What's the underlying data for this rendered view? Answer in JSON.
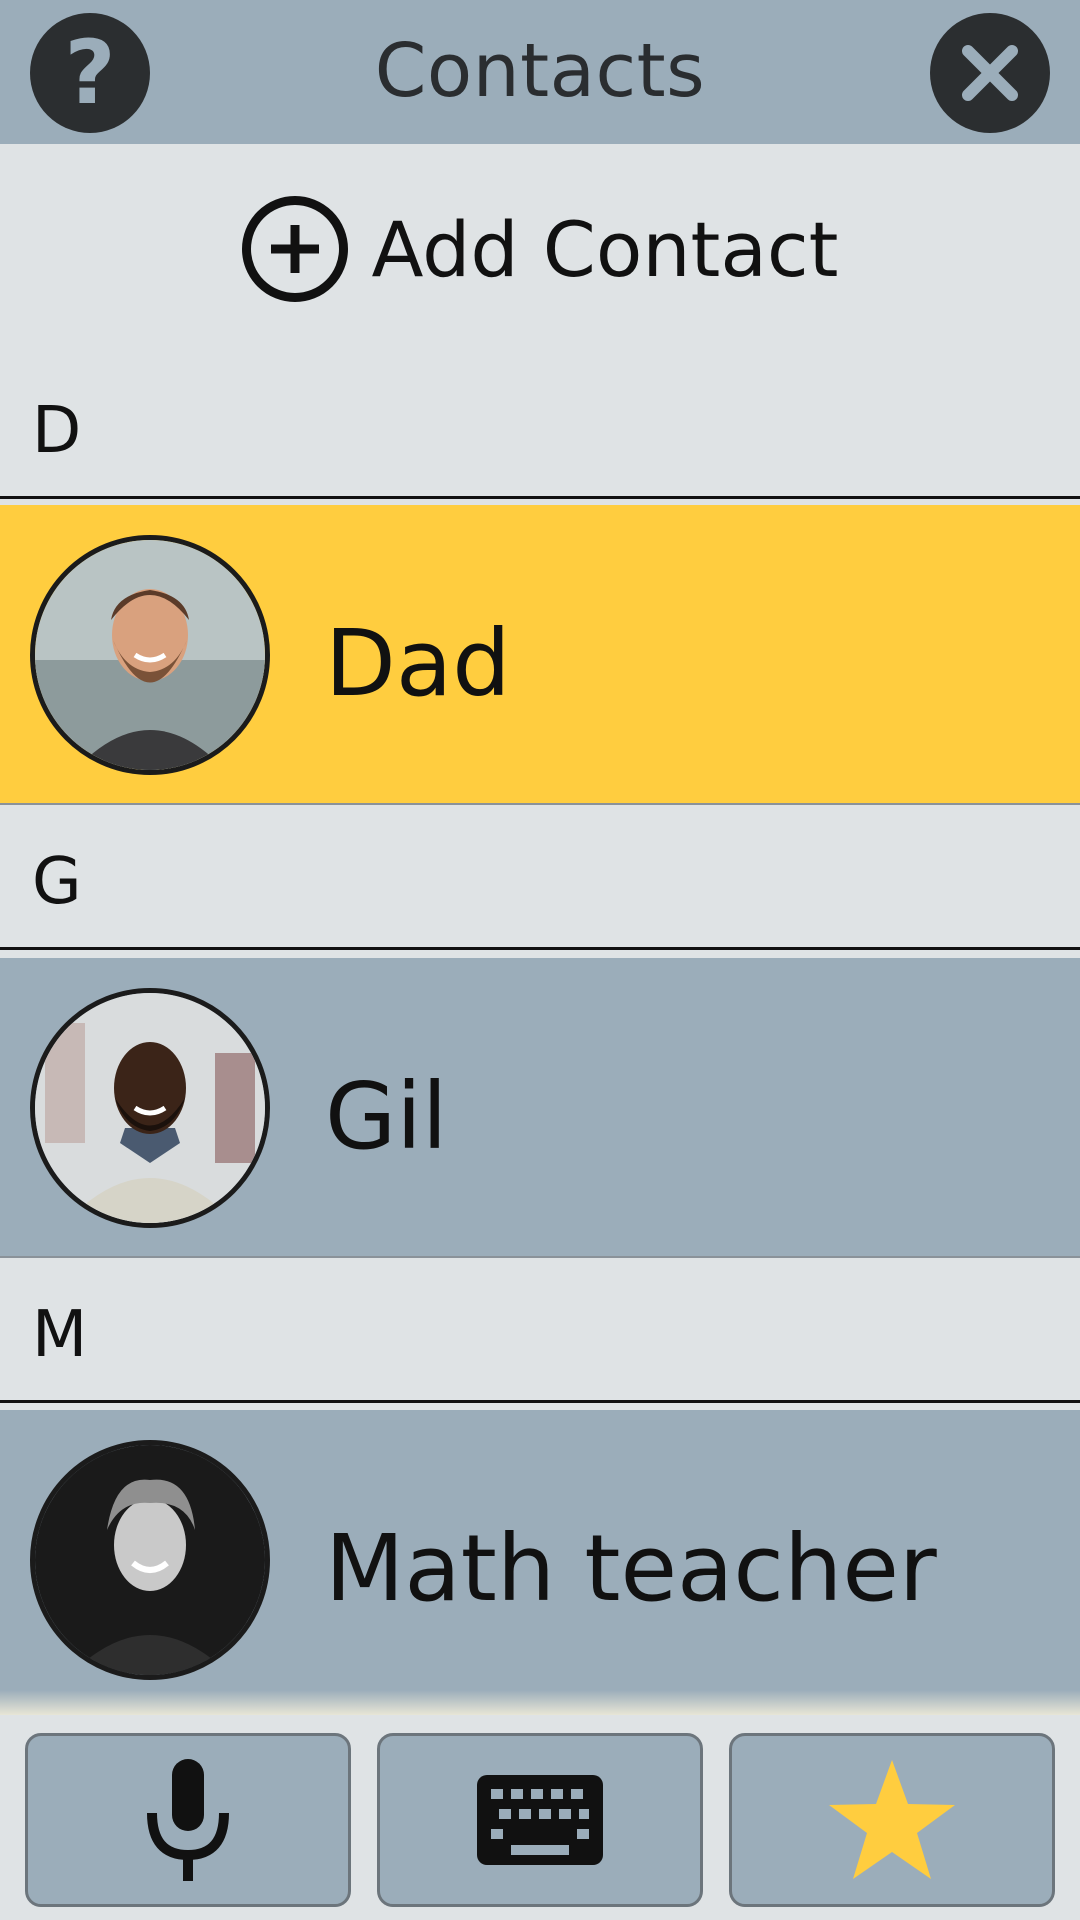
{
  "header": {
    "title": "Contacts",
    "help_icon": "question-mark-icon",
    "close_icon": "close-icon"
  },
  "add_contact": {
    "label": "Add Contact",
    "icon": "plus-circle-icon"
  },
  "sections": [
    {
      "letter": "D",
      "contacts": [
        {
          "name": "Dad",
          "selected": true,
          "avatar": "bearded-man-photo"
        }
      ]
    },
    {
      "letter": "G",
      "contacts": [
        {
          "name": "Gil",
          "selected": false,
          "avatar": "smiling-man-photo"
        }
      ]
    },
    {
      "letter": "M",
      "contacts": [
        {
          "name": "Math teacher",
          "selected": false,
          "avatar": "curly-hair-man-bw-photo"
        }
      ]
    }
  ],
  "toolbar": {
    "buttons": [
      {
        "icon": "microphone-icon"
      },
      {
        "icon": "keyboard-icon"
      },
      {
        "icon": "star-icon"
      }
    ]
  },
  "colors": {
    "header_bg": "#9badba",
    "list_bg": "#dfe3e5",
    "selected_bg": "#ffcd3f",
    "row_bg": "#9badba",
    "star": "#ffcd3f",
    "dark": "#2b2e30"
  }
}
